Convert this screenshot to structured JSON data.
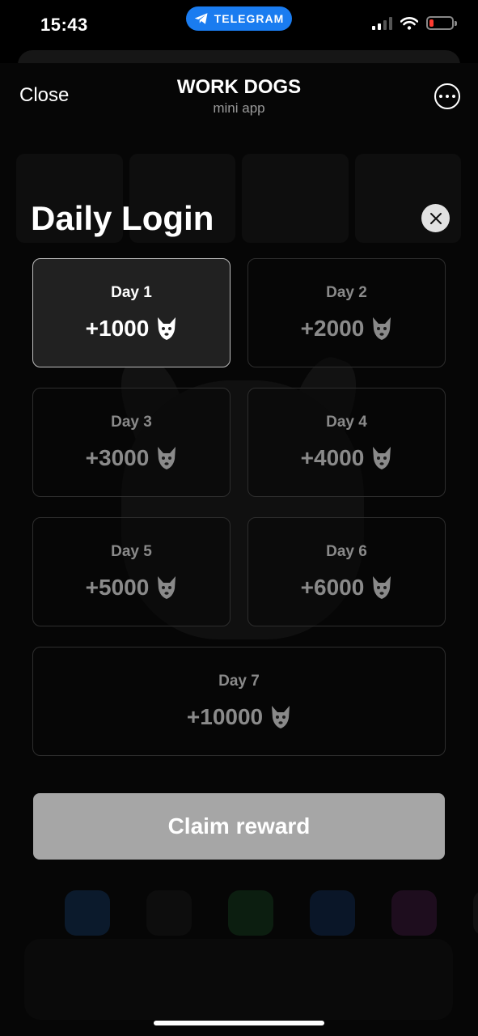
{
  "status_bar": {
    "time": "15:43",
    "telegram_label": "TELEGRAM",
    "battery_color": "#ff3b30"
  },
  "header": {
    "close_label": "Close",
    "title": "WORK DOGS",
    "subtitle": "mini app"
  },
  "modal": {
    "title": "Daily Login",
    "days": [
      {
        "label": "Day 1",
        "reward": "+1000",
        "active": true
      },
      {
        "label": "Day 2",
        "reward": "+2000",
        "active": false
      },
      {
        "label": "Day 3",
        "reward": "+3000",
        "active": false
      },
      {
        "label": "Day 4",
        "reward": "+4000",
        "active": false
      },
      {
        "label": "Day 5",
        "reward": "+5000",
        "active": false
      },
      {
        "label": "Day 6",
        "reward": "+6000",
        "active": false
      },
      {
        "label": "Day 7",
        "reward": "+10000",
        "active": false
      }
    ],
    "claim_label": "Claim reward"
  },
  "colors": {
    "accent_telegram": "#1a7cf0",
    "claim_button": "#a6a6a6",
    "inactive_text": "#8a8a8a"
  }
}
